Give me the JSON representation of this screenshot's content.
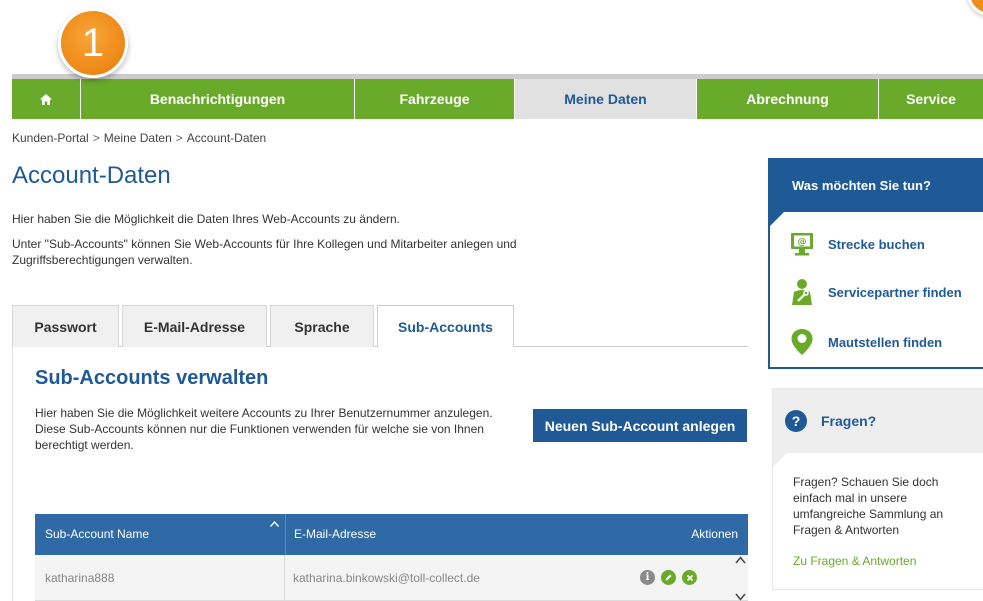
{
  "step_badge": "1",
  "nav": {
    "items": [
      {
        "label": "Benachrichtigungen"
      },
      {
        "label": "Fahrzeuge"
      },
      {
        "label": "Meine Daten"
      },
      {
        "label": "Abrechnung"
      },
      {
        "label": "Service"
      }
    ]
  },
  "breadcrumb": [
    "Kunden-Portal",
    "Meine Daten",
    "Account-Daten"
  ],
  "breadcrumb_separator": ">",
  "page": {
    "title": "Account-Daten",
    "intro_1": "Hier haben Sie die Möglichkeit die Daten Ihres Web-Accounts zu ändern.",
    "intro_2": "Unter \"Sub-Accounts\" können Sie Web-Accounts für Ihre Kollegen und Mitarbeiter anlegen und Zugriffsberechtigungen verwalten."
  },
  "tabs": [
    {
      "label": "Passwort"
    },
    {
      "label": "E-Mail-Adresse"
    },
    {
      "label": "Sprache"
    },
    {
      "label": "Sub-Accounts",
      "active": true
    }
  ],
  "section": {
    "title": "Sub-Accounts verwalten",
    "text": "Hier haben Sie die Möglichkeit weitere Accounts zu Ihrer Benutzernummer anzulegen. Diese Sub-Accounts können nur die Funktionen verwenden für welche sie von Ihnen berechtigt werden.",
    "new_button": "Neuen Sub-Account anlegen"
  },
  "table": {
    "columns": [
      "Sub-Account Name",
      "E-Mail-Adresse",
      "Aktionen"
    ],
    "rows": [
      {
        "name": "katharina888",
        "email": "katharina.binkowski@toll-collect.de"
      }
    ]
  },
  "sidebar": {
    "title": "Was möchten Sie tun?",
    "items": [
      {
        "label": "Strecke buchen",
        "icon": "monitor-at-icon"
      },
      {
        "label": "Servicepartner finden",
        "icon": "mechanic-icon"
      },
      {
        "label": "Mautstellen finden",
        "icon": "map-pin-icon"
      }
    ]
  },
  "faq": {
    "title": "Fragen?",
    "text": "Fragen? Schauen Sie doch einfach mal in unsere umfangreiche Sammlung an Fragen & Antworten",
    "link": "Zu Fragen & Antworten"
  },
  "colors": {
    "nav_green": "#6aaa2b",
    "brand_blue": "#1f5a96",
    "table_header": "#2f6aa6",
    "badge_orange": "#f08c1a"
  }
}
